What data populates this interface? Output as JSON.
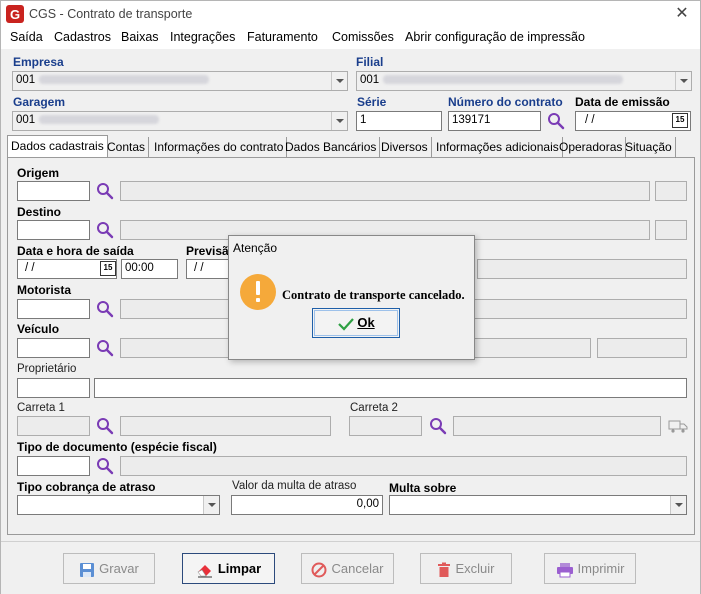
{
  "window": {
    "title": "CGS - Contrato de transporte"
  },
  "menu": [
    "Saída",
    "Cadastros",
    "Baixas",
    "Integrações",
    "Faturamento",
    "Comissões",
    "Abrir configuração de impressão"
  ],
  "header": {
    "empresa_label": "Empresa",
    "empresa_code": "001",
    "filial_label": "Filial",
    "filial_code": "001",
    "garagem_label": "Garagem",
    "garagem_code": "001",
    "serie_label": "Série",
    "serie_value": "1",
    "numero_label": "Número do contrato",
    "numero_value": "139171",
    "data_emissao_label": "Data de emissão",
    "data_emissao_value": "/ /"
  },
  "tabs": [
    "Dados cadastrais",
    "Contas",
    "Informações do contrato",
    "Dados Bancários",
    "Diversos",
    "Informações adicionais",
    "Operadoras",
    "Situação"
  ],
  "form": {
    "origem_label": "Origem",
    "destino_label": "Destino",
    "data_saida_label": "Data e hora de saída",
    "data_saida_value": "/ /",
    "hora_saida_value": "00:00",
    "previsao_label": "Previsã",
    "previsao_value": "/ /",
    "motorista_label": "Motorista",
    "veiculo_label": "Veículo",
    "proprietario_label": "Proprietário",
    "carreta1_label": "Carreta 1",
    "carreta2_label": "Carreta 2",
    "tipo_doc_label": "Tipo de documento (espécie fiscal)",
    "tipo_cobranca_label": "Tipo cobrança de atraso",
    "valor_multa_label": "Valor da multa de atraso",
    "valor_multa_value": "0,00",
    "multa_sobre_label": "Multa sobre"
  },
  "buttons": {
    "gravar": "Gravar",
    "limpar": "Limpar",
    "cancelar": "Cancelar",
    "excluir": "Excluir",
    "imprimir": "Imprimir"
  },
  "dialog": {
    "title": "Atenção",
    "message": "Contrato de transporte cancelado.",
    "ok": "Ok"
  },
  "colors": {
    "label_blue": "#1a3e8c",
    "warning_orange": "#f5a93a",
    "ok_check": "#2ea043",
    "logo_red": "#c9231f"
  }
}
